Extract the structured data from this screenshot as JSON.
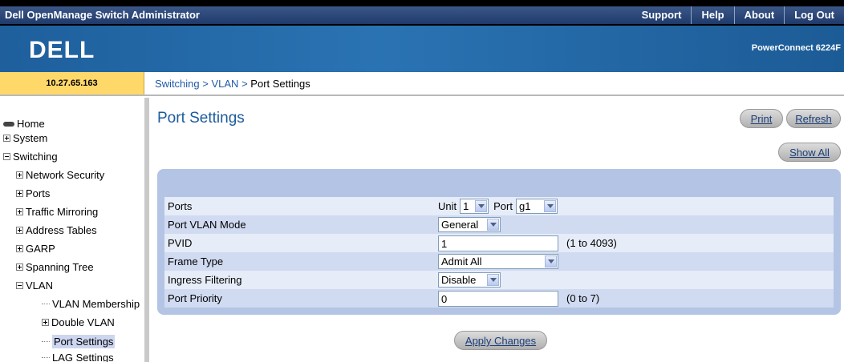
{
  "header": {
    "app_title": "Dell OpenManage Switch Administrator",
    "links": [
      "Support",
      "Help",
      "About",
      "Log Out"
    ],
    "logo_text": "DELL",
    "model": "PowerConnect 6224F"
  },
  "info": {
    "ip": "10.27.65.163",
    "breadcrumb": [
      "Switching",
      "VLAN",
      "Port Settings"
    ],
    "separator": ">"
  },
  "sidebar": {
    "items": [
      {
        "label": "Home"
      },
      {
        "label": "System"
      },
      {
        "label": "Switching"
      },
      {
        "label": "Network Security"
      },
      {
        "label": "Ports"
      },
      {
        "label": "Traffic Mirroring"
      },
      {
        "label": "Address Tables"
      },
      {
        "label": "GARP"
      },
      {
        "label": "Spanning Tree"
      },
      {
        "label": "VLAN"
      },
      {
        "label": "VLAN Membership"
      },
      {
        "label": "Double VLAN"
      },
      {
        "label": "Port Settings"
      },
      {
        "label": "LAG Settings"
      }
    ]
  },
  "main": {
    "title": "Port Settings",
    "print_label": "Print",
    "refresh_label": "Refresh",
    "show_all_label": "Show All",
    "apply_label": "Apply Changes",
    "form": {
      "ports_label": "Ports",
      "unit_label": "Unit",
      "unit_value": "1",
      "port_label": "Port",
      "port_value": "g1",
      "mode_label": "Port VLAN Mode",
      "mode_value": "General",
      "pvid_label": "PVID",
      "pvid_value": "1",
      "pvid_hint": "(1 to 4093)",
      "frame_label": "Frame Type",
      "frame_value": "Admit All",
      "ingress_label": "Ingress Filtering",
      "ingress_value": "Disable",
      "priority_label": "Port Priority",
      "priority_value": "0",
      "priority_hint": "(0 to 7)"
    }
  },
  "colors": {
    "banner": "#1e5f9c",
    "ip_cell": "#ffd86a",
    "panel": "#b4c4e4",
    "link": "#1f5aa6"
  }
}
